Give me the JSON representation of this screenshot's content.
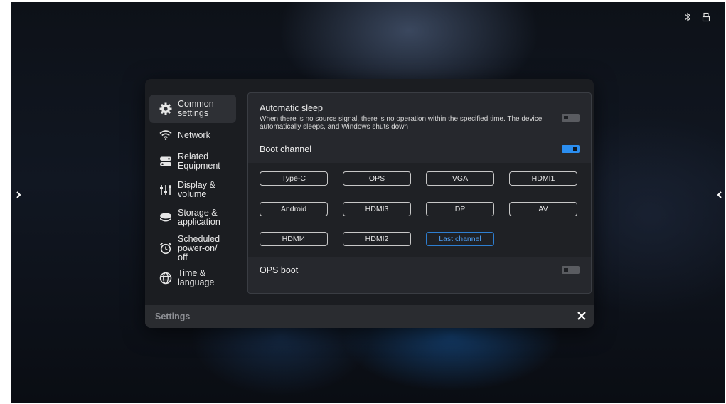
{
  "status_bar": {
    "icons": [
      "bluetooth-icon",
      "usb-icon"
    ]
  },
  "side_arrows": {
    "left_icon": "chevron-right-icon",
    "right_icon": "chevron-left-icon"
  },
  "sidebar": {
    "items": [
      {
        "label": "Common settings",
        "icon": "gear-icon",
        "active": true
      },
      {
        "label": "Network",
        "icon": "wifi-icon",
        "active": false
      },
      {
        "label": "Related Equipment",
        "icon": "device-icon",
        "active": false
      },
      {
        "label": "Display & volume",
        "icon": "sliders-icon",
        "active": false
      },
      {
        "label": "Storage & application",
        "icon": "storage-icon",
        "active": false
      },
      {
        "label": "Scheduled power-on/ off",
        "icon": "alarm-clock-icon",
        "active": false
      },
      {
        "label": "Time & language",
        "icon": "globe-icon",
        "active": false
      }
    ]
  },
  "settings": {
    "automatic_sleep": {
      "title": "Automatic sleep",
      "description": "When there is no source signal, there is no operation within the specified time. The device automatically sleeps, and Windows shuts down",
      "enabled": false
    },
    "boot_channel": {
      "title": "Boot channel",
      "enabled": true,
      "selected": "Last channel",
      "options": [
        "Type-C",
        "OPS",
        "VGA",
        "HDMI1",
        "Android",
        "HDMI3",
        "DP",
        "AV",
        "HDMI4",
        "HDMI2",
        "Last channel"
      ]
    },
    "ops_boot": {
      "title": "OPS boot",
      "enabled": false
    }
  },
  "footer": {
    "title": "Settings",
    "close_icon": "close-icon"
  },
  "colors": {
    "accent": "#2b8ef0",
    "panel": "#1b1d21",
    "content": "#26282d"
  }
}
